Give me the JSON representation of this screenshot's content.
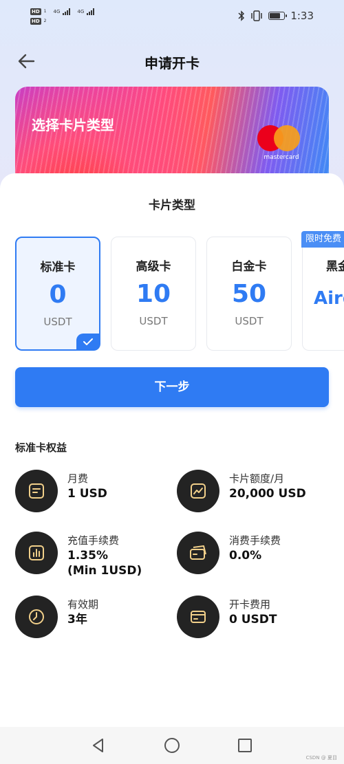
{
  "status_bar": {
    "sim1_label": "HD",
    "sim1_sub": "1",
    "sim2_label": "HD",
    "sim2_sub": "2",
    "network1": "4G",
    "network2": "4G",
    "time": "1:33",
    "battery_level_fraction": 0.75
  },
  "header": {
    "title": "申请开卡",
    "back_icon": "arrow-left-icon"
  },
  "banner": {
    "text": "选择卡片类型",
    "brand_label": "mastercard",
    "brand_colors": [
      "#eb001b",
      "#f79e1b"
    ]
  },
  "card_section": {
    "title": "卡片类型",
    "badge": "限时免费",
    "cards": [
      {
        "name": "标准卡",
        "price": "0",
        "unit": "USDT",
        "selected": true
      },
      {
        "name": "高级卡",
        "price": "10",
        "unit": "USDT",
        "selected": false
      },
      {
        "name": "白金卡",
        "price": "50",
        "unit": "USDT",
        "selected": false
      },
      {
        "name": "黑金卡",
        "price": "Aird",
        "unit": "",
        "selected": false
      }
    ]
  },
  "next_button": "下一步",
  "benefits": {
    "title": "标准卡权益",
    "items": [
      {
        "label": "月费",
        "value": "1 USD",
        "icon": "document-icon"
      },
      {
        "label": "卡片额度/月",
        "value": "20,000 USD",
        "icon": "trend-chart-icon"
      },
      {
        "label": "充值手续费",
        "value": "1.35%",
        "value2": "(Min 1USD)",
        "icon": "bar-chart-icon"
      },
      {
        "label": "消费手续费",
        "value": "0.0%",
        "icon": "cards-icon"
      },
      {
        "label": "有效期",
        "value": "3年",
        "icon": "clock-icon"
      },
      {
        "label": "开卡费用",
        "value": "0 USDT",
        "icon": "credit-card-icon"
      }
    ]
  },
  "nav": {
    "back": "triangle-back-icon",
    "home": "circle-home-icon",
    "recent": "square-recent-icon"
  },
  "watermark": "CSDN @ 夏目",
  "colors": {
    "accent": "#2f7bf3",
    "icon_bg": "#232323",
    "icon_stroke": "#f2d08a"
  }
}
